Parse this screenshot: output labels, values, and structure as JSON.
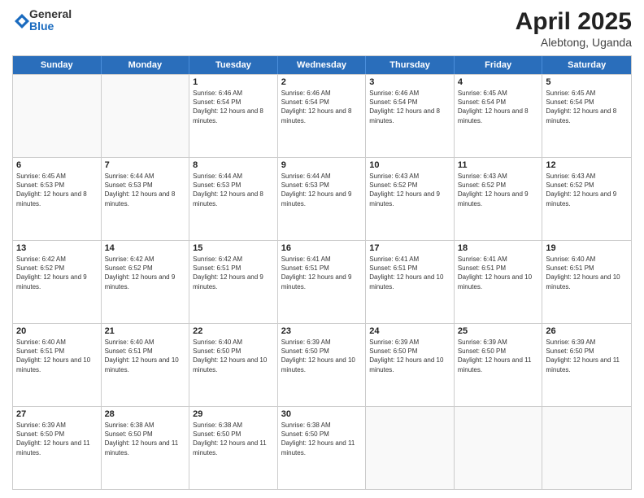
{
  "header": {
    "logo_general": "General",
    "logo_blue": "Blue",
    "month": "April 2025",
    "location": "Alebtong, Uganda"
  },
  "days_of_week": [
    "Sunday",
    "Monday",
    "Tuesday",
    "Wednesday",
    "Thursday",
    "Friday",
    "Saturday"
  ],
  "weeks": [
    [
      {
        "day": "",
        "sunrise": "",
        "sunset": "",
        "daylight": ""
      },
      {
        "day": "",
        "sunrise": "",
        "sunset": "",
        "daylight": ""
      },
      {
        "day": "1",
        "sunrise": "Sunrise: 6:46 AM",
        "sunset": "Sunset: 6:54 PM",
        "daylight": "Daylight: 12 hours and 8 minutes."
      },
      {
        "day": "2",
        "sunrise": "Sunrise: 6:46 AM",
        "sunset": "Sunset: 6:54 PM",
        "daylight": "Daylight: 12 hours and 8 minutes."
      },
      {
        "day": "3",
        "sunrise": "Sunrise: 6:46 AM",
        "sunset": "Sunset: 6:54 PM",
        "daylight": "Daylight: 12 hours and 8 minutes."
      },
      {
        "day": "4",
        "sunrise": "Sunrise: 6:45 AM",
        "sunset": "Sunset: 6:54 PM",
        "daylight": "Daylight: 12 hours and 8 minutes."
      },
      {
        "day": "5",
        "sunrise": "Sunrise: 6:45 AM",
        "sunset": "Sunset: 6:54 PM",
        "daylight": "Daylight: 12 hours and 8 minutes."
      }
    ],
    [
      {
        "day": "6",
        "sunrise": "Sunrise: 6:45 AM",
        "sunset": "Sunset: 6:53 PM",
        "daylight": "Daylight: 12 hours and 8 minutes."
      },
      {
        "day": "7",
        "sunrise": "Sunrise: 6:44 AM",
        "sunset": "Sunset: 6:53 PM",
        "daylight": "Daylight: 12 hours and 8 minutes."
      },
      {
        "day": "8",
        "sunrise": "Sunrise: 6:44 AM",
        "sunset": "Sunset: 6:53 PM",
        "daylight": "Daylight: 12 hours and 8 minutes."
      },
      {
        "day": "9",
        "sunrise": "Sunrise: 6:44 AM",
        "sunset": "Sunset: 6:53 PM",
        "daylight": "Daylight: 12 hours and 9 minutes."
      },
      {
        "day": "10",
        "sunrise": "Sunrise: 6:43 AM",
        "sunset": "Sunset: 6:52 PM",
        "daylight": "Daylight: 12 hours and 9 minutes."
      },
      {
        "day": "11",
        "sunrise": "Sunrise: 6:43 AM",
        "sunset": "Sunset: 6:52 PM",
        "daylight": "Daylight: 12 hours and 9 minutes."
      },
      {
        "day": "12",
        "sunrise": "Sunrise: 6:43 AM",
        "sunset": "Sunset: 6:52 PM",
        "daylight": "Daylight: 12 hours and 9 minutes."
      }
    ],
    [
      {
        "day": "13",
        "sunrise": "Sunrise: 6:42 AM",
        "sunset": "Sunset: 6:52 PM",
        "daylight": "Daylight: 12 hours and 9 minutes."
      },
      {
        "day": "14",
        "sunrise": "Sunrise: 6:42 AM",
        "sunset": "Sunset: 6:52 PM",
        "daylight": "Daylight: 12 hours and 9 minutes."
      },
      {
        "day": "15",
        "sunrise": "Sunrise: 6:42 AM",
        "sunset": "Sunset: 6:51 PM",
        "daylight": "Daylight: 12 hours and 9 minutes."
      },
      {
        "day": "16",
        "sunrise": "Sunrise: 6:41 AM",
        "sunset": "Sunset: 6:51 PM",
        "daylight": "Daylight: 12 hours and 9 minutes."
      },
      {
        "day": "17",
        "sunrise": "Sunrise: 6:41 AM",
        "sunset": "Sunset: 6:51 PM",
        "daylight": "Daylight: 12 hours and 10 minutes."
      },
      {
        "day": "18",
        "sunrise": "Sunrise: 6:41 AM",
        "sunset": "Sunset: 6:51 PM",
        "daylight": "Daylight: 12 hours and 10 minutes."
      },
      {
        "day": "19",
        "sunrise": "Sunrise: 6:40 AM",
        "sunset": "Sunset: 6:51 PM",
        "daylight": "Daylight: 12 hours and 10 minutes."
      }
    ],
    [
      {
        "day": "20",
        "sunrise": "Sunrise: 6:40 AM",
        "sunset": "Sunset: 6:51 PM",
        "daylight": "Daylight: 12 hours and 10 minutes."
      },
      {
        "day": "21",
        "sunrise": "Sunrise: 6:40 AM",
        "sunset": "Sunset: 6:51 PM",
        "daylight": "Daylight: 12 hours and 10 minutes."
      },
      {
        "day": "22",
        "sunrise": "Sunrise: 6:40 AM",
        "sunset": "Sunset: 6:50 PM",
        "daylight": "Daylight: 12 hours and 10 minutes."
      },
      {
        "day": "23",
        "sunrise": "Sunrise: 6:39 AM",
        "sunset": "Sunset: 6:50 PM",
        "daylight": "Daylight: 12 hours and 10 minutes."
      },
      {
        "day": "24",
        "sunrise": "Sunrise: 6:39 AM",
        "sunset": "Sunset: 6:50 PM",
        "daylight": "Daylight: 12 hours and 10 minutes."
      },
      {
        "day": "25",
        "sunrise": "Sunrise: 6:39 AM",
        "sunset": "Sunset: 6:50 PM",
        "daylight": "Daylight: 12 hours and 11 minutes."
      },
      {
        "day": "26",
        "sunrise": "Sunrise: 6:39 AM",
        "sunset": "Sunset: 6:50 PM",
        "daylight": "Daylight: 12 hours and 11 minutes."
      }
    ],
    [
      {
        "day": "27",
        "sunrise": "Sunrise: 6:39 AM",
        "sunset": "Sunset: 6:50 PM",
        "daylight": "Daylight: 12 hours and 11 minutes."
      },
      {
        "day": "28",
        "sunrise": "Sunrise: 6:38 AM",
        "sunset": "Sunset: 6:50 PM",
        "daylight": "Daylight: 12 hours and 11 minutes."
      },
      {
        "day": "29",
        "sunrise": "Sunrise: 6:38 AM",
        "sunset": "Sunset: 6:50 PM",
        "daylight": "Daylight: 12 hours and 11 minutes."
      },
      {
        "day": "30",
        "sunrise": "Sunrise: 6:38 AM",
        "sunset": "Sunset: 6:50 PM",
        "daylight": "Daylight: 12 hours and 11 minutes."
      },
      {
        "day": "",
        "sunrise": "",
        "sunset": "",
        "daylight": ""
      },
      {
        "day": "",
        "sunrise": "",
        "sunset": "",
        "daylight": ""
      },
      {
        "day": "",
        "sunrise": "",
        "sunset": "",
        "daylight": ""
      }
    ]
  ]
}
